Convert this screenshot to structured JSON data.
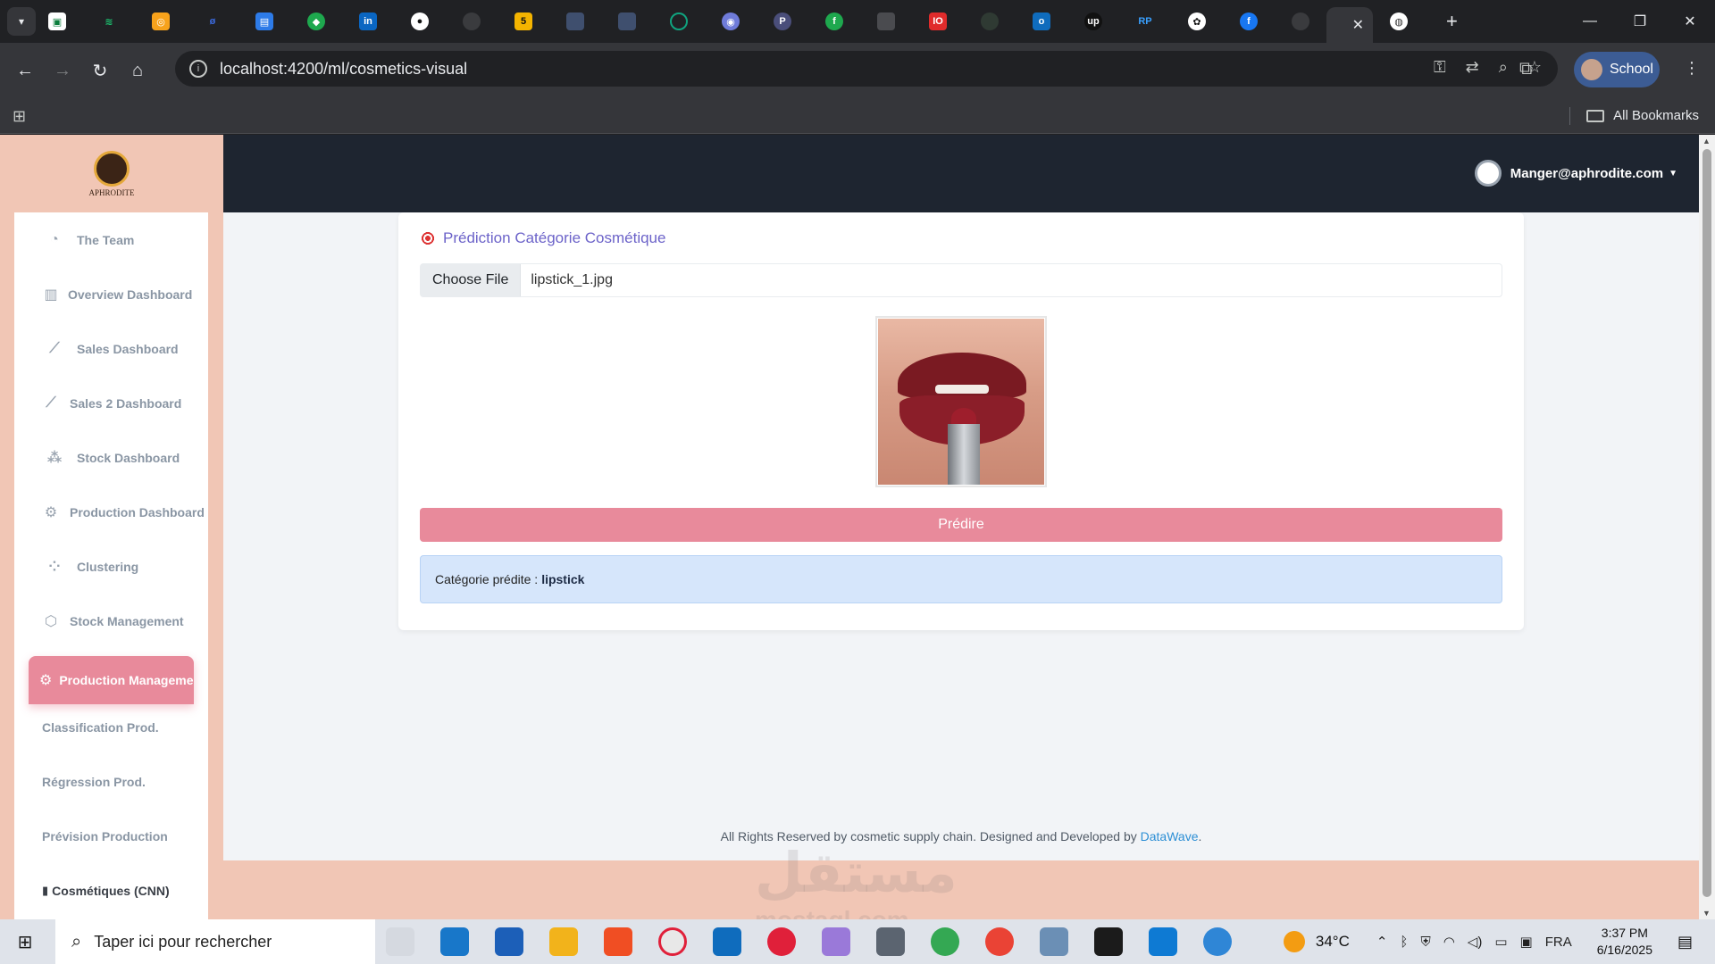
{
  "browser": {
    "active_tab_close": "✕",
    "new_tab": "+",
    "url": "localhost:4200/ml/cosmetics-visual",
    "profile_label": "School",
    "bookmarks_label": "All Bookmarks"
  },
  "app": {
    "logo_text": "APHRODITE",
    "user_email": "Manger@aphrodite.com",
    "sidebar": {
      "items": [
        {
          "label": "The Team",
          "icon": "dashboard-gauge-icon"
        },
        {
          "label": "Overview Dashboard",
          "icon": "bar-chart-icon"
        },
        {
          "label": "Sales Dashboard",
          "icon": "line-chart-icon"
        },
        {
          "label": "Sales 2 Dashboard",
          "icon": "line-chart-icon"
        },
        {
          "label": "Stock Dashboard",
          "icon": "boxes-icon"
        },
        {
          "label": "Production Dashboard",
          "icon": "gear-icon"
        },
        {
          "label": "Clustering",
          "icon": "cluster-icon"
        },
        {
          "label": "Stock Management",
          "icon": "cube-icon"
        },
        {
          "label": "Production Management",
          "icon": "gear-icon"
        }
      ],
      "sub_items": [
        {
          "label": "Classification Prod."
        },
        {
          "label": "Régression Prod."
        },
        {
          "label": "Prévision Production"
        },
        {
          "label": "Cosmétiques (CNN)"
        }
      ]
    },
    "card": {
      "title": "Prédiction Catégorie Cosmétique",
      "file_button": "Choose File",
      "file_name": "lipstick_1.jpg",
      "predict_button": "Prédire",
      "result_label": "Catégorie prédite :",
      "result_value": "lipstick"
    },
    "footer": {
      "text": "All Rights Reserved by cosmetic supply chain. Designed and Developed by",
      "link": "DataWave",
      "suffix": "."
    },
    "watermark": "مستقل",
    "watermark_sub": "mostaql.com"
  },
  "taskbar": {
    "search_placeholder": "Taper ici pour rechercher",
    "temperature": "34°C",
    "language": "FRA",
    "time": "3:37 PM",
    "date": "6/16/2025"
  },
  "colors": {
    "accent_pink": "#e88a9b",
    "sidebar_bg": "#f1c6b5",
    "topbar_bg": "#1e2530",
    "title_purple": "#6c63c9",
    "result_bg": "#d6e6fb"
  }
}
